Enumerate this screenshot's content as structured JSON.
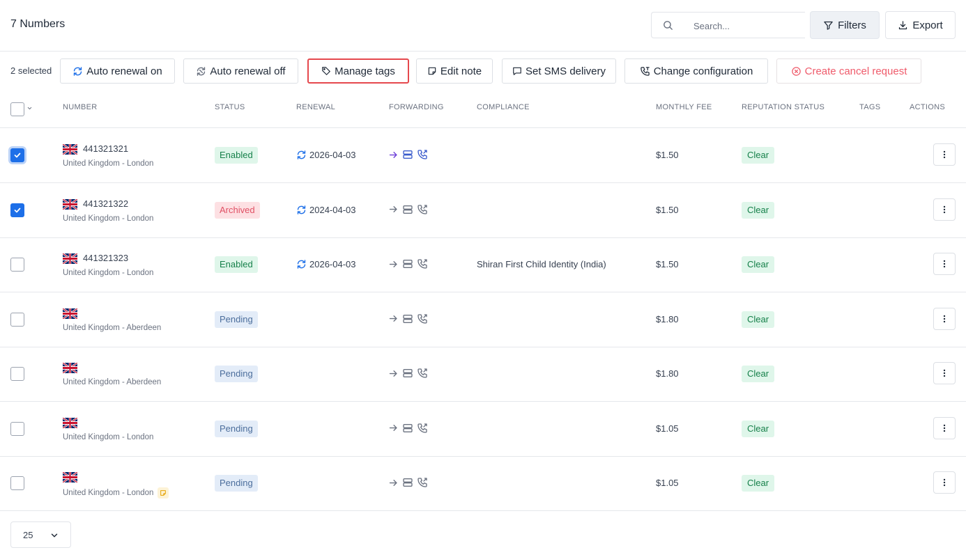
{
  "header": {
    "title": "7 Numbers",
    "search_placeholder": "Search...",
    "filters_label": "Filters",
    "export_label": "Export"
  },
  "action_bar": {
    "selected_count": "2 selected",
    "buttons": [
      {
        "label": "Auto renewal on",
        "icon": "refresh-icon"
      },
      {
        "label": "Auto renewal off",
        "icon": "refresh-off-icon"
      },
      {
        "label": "Manage tags",
        "icon": "tag-icon",
        "highlighted": true
      },
      {
        "label": "Edit note",
        "icon": "note-icon"
      },
      {
        "label": "Set SMS delivery",
        "icon": "message-icon"
      },
      {
        "label": "Change configuration",
        "icon": "phone-settings-icon"
      },
      {
        "label": "Create cancel request",
        "icon": "cancel-circle-icon",
        "danger": true
      }
    ]
  },
  "table": {
    "columns": [
      "NUMBER",
      "STATUS",
      "RENEWAL",
      "FORWARDING",
      "COMPLIANCE",
      "MONTHLY FEE",
      "REPUTATION STATUS",
      "TAGS",
      "ACTIONS"
    ],
    "rows": [
      {
        "checked": true,
        "focused": true,
        "number": "441321321",
        "location": "United Kingdom - London",
        "status": "Enabled",
        "status_kind": "enabled",
        "renewal": "2026-04-03",
        "forwarding_active": true,
        "compliance": "",
        "fee": "$1.50",
        "reputation": "Clear",
        "has_note": false
      },
      {
        "checked": true,
        "focused": false,
        "number": "441321322",
        "location": "United Kingdom - London",
        "status": "Archived",
        "status_kind": "archived",
        "renewal": "2024-04-03",
        "forwarding_active": false,
        "compliance": "",
        "fee": "$1.50",
        "reputation": "Clear",
        "has_note": false
      },
      {
        "checked": false,
        "focused": false,
        "number": "441321323",
        "location": "United Kingdom - London",
        "status": "Enabled",
        "status_kind": "enabled",
        "renewal": "2026-04-03",
        "forwarding_active": false,
        "compliance": "Shiran First Child Identity (India)",
        "fee": "$1.50",
        "reputation": "Clear",
        "has_note": false
      },
      {
        "checked": false,
        "focused": false,
        "number": "",
        "location": "United Kingdom - Aberdeen",
        "status": "Pending",
        "status_kind": "pending",
        "renewal": "",
        "forwarding_active": false,
        "compliance": "",
        "fee": "$1.80",
        "reputation": "Clear",
        "has_note": false
      },
      {
        "checked": false,
        "focused": false,
        "number": "",
        "location": "United Kingdom - Aberdeen",
        "status": "Pending",
        "status_kind": "pending",
        "renewal": "",
        "forwarding_active": false,
        "compliance": "",
        "fee": "$1.80",
        "reputation": "Clear",
        "has_note": false
      },
      {
        "checked": false,
        "focused": false,
        "number": "",
        "location": "United Kingdom - London",
        "status": "Pending",
        "status_kind": "pending",
        "renewal": "",
        "forwarding_active": false,
        "compliance": "",
        "fee": "$1.05",
        "reputation": "Clear",
        "has_note": false
      },
      {
        "checked": false,
        "focused": false,
        "number": "",
        "location": "United Kingdom - London",
        "status": "Pending",
        "status_kind": "pending",
        "renewal": "",
        "forwarding_active": false,
        "compliance": "",
        "fee": "$1.05",
        "reputation": "Clear",
        "has_note": true
      }
    ]
  },
  "pagination": {
    "page_size": "25"
  },
  "colors": {
    "primary": "#1d6fe8",
    "highlight_border": "#e5484d",
    "danger": "#ef5b6b",
    "success_text": "#16804a",
    "success_bg": "#dff6ea",
    "forwarding_active": "#6d3fd8",
    "forwarding_active_secondary": "#3b5ccc"
  }
}
